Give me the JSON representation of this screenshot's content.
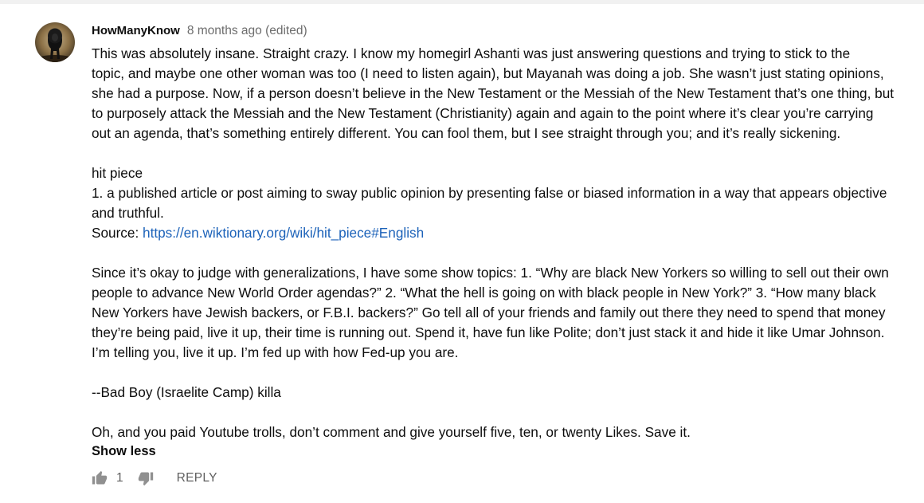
{
  "comment": {
    "author": "HowManyKnow",
    "timestamp": "8 months ago (edited)",
    "lines": {
      "l1": "This was absolutely insane.  Straight crazy.  I know my homegirl Ashanti was just answering questions and trying to stick to the",
      "l2": "topic, and maybe one other woman was too (I need to listen again), but Mayanah was doing a job.  She wasn’t just stating opinions,",
      "l3": "she had a purpose.  Now, if a person doesn’t believe in the New Testament or the Messiah of the New Testament that’s one thing, but",
      "l4": "to purposely attack the Messiah and the New Testament (Christianity) again and again to the point where it’s clear you’re carrying",
      "l5": "out an agenda, that’s something entirely different.  You can fool them, but I see straight through you; and it’s really sickening.",
      "l6": "hit piece",
      "l7": "1. a published article or post aiming to sway public opinion by presenting false or biased information in a way that appears objective",
      "l8": "and truthful.",
      "l9_prefix": "Source: ",
      "l9_link": "https://en.wiktionary.org/wiki/hit_piece#English",
      "l10": "Since it’s okay to judge with generalizations, I have some show topics:  1. “Why are black New Yorkers so willing to sell out their own",
      "l11": "people to advance New World Order agendas?”  2. “What the hell is going on with black people in New York?”  3. “How many black",
      "l12": "New Yorkers have Jewish backers, or F.B.I. backers?”  Go tell all of your friends and family out there they need to spend that money",
      "l13": "they’re being paid, live it up, their time is running out.  Spend it, have fun like Polite; don’t just stack it and hide it like Umar Johnson.",
      "l14": "I’m telling you, live it up.  I’m fed up with how Fed-up you are.",
      "l15": "--Bad Boy (Israelite Camp) killa",
      "l16": "Oh, and you paid Youtube trolls, don’t comment and give yourself five, ten, or twenty Likes.  Save it."
    },
    "show_less_label": "Show less",
    "like_count": "1",
    "reply_label": "REPLY"
  },
  "icons": {
    "avatar": "lion-avatar",
    "like": "thumbs-up-icon",
    "dislike": "thumbs-down-icon"
  },
  "colors": {
    "link": "#1c62b9",
    "meta_text": "#6d6d6d",
    "action_icon": "#909090"
  }
}
